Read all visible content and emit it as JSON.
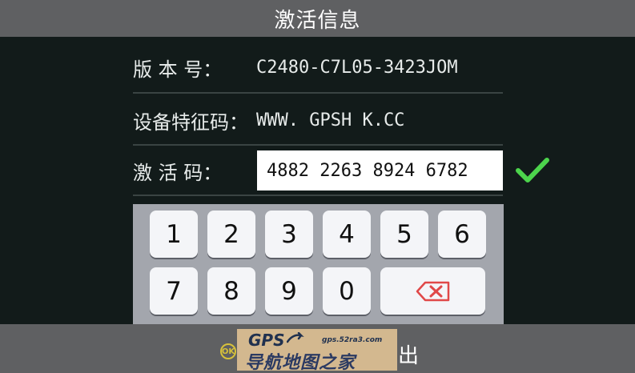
{
  "header": {
    "title": "激活信息"
  },
  "info": {
    "version_label": "版 本 号：",
    "version_value": "C2480-C7L05-3423JOM",
    "device_label": "设备特征码：",
    "device_value": "WWW. GPSH K.CC",
    "activation_label": "激 活 码：",
    "activation_value": "4882 2263 8924 6782"
  },
  "colors": {
    "confirm_check": "#4cd44c",
    "delete_icon": "#e04848",
    "ok_icon": "#d7c13a"
  },
  "keypad": {
    "row1": [
      "1",
      "2",
      "3",
      "4",
      "5",
      "6"
    ],
    "row2": [
      "7",
      "8",
      "9",
      "0"
    ],
    "delete_icon": "backspace-x-icon"
  },
  "footer": {
    "ok_icon_text": "OK",
    "exit_label": "出"
  },
  "watermark": {
    "brand": "GPS",
    "url": "gps.52ra3.com",
    "name": "导航地图之家"
  }
}
